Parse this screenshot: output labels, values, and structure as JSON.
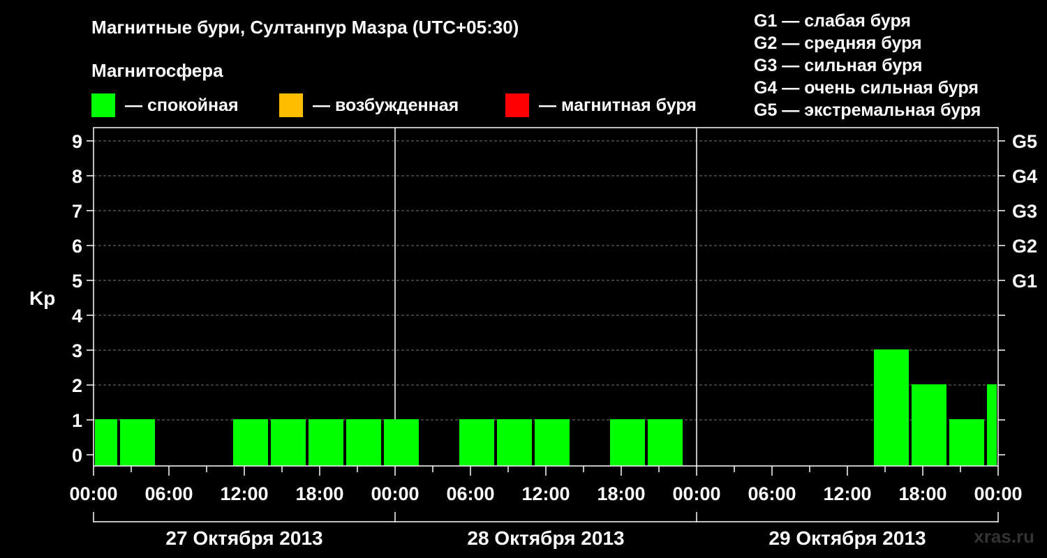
{
  "title": "Магнитные бури, Султанпур Мазра (UTC+05:30)",
  "section_label": "Магнитосфера",
  "legend": [
    {
      "color": "#00ff00",
      "label": "— спокойная"
    },
    {
      "color": "#ffbf00",
      "label": "— возбужденная"
    },
    {
      "color": "#ff0000",
      "label": "— магнитная буря"
    }
  ],
  "g_scale": [
    "G1 — слабая буря",
    "G2 — средняя буря",
    "G3 — сильная буря",
    "G4 — очень сильная буря",
    "G5 — экстремальная буря"
  ],
  "watermark": "xras.ru",
  "chart_data": {
    "type": "bar",
    "ylabel": "Kp",
    "ylim": [
      0,
      9
    ],
    "yticks": [
      0,
      1,
      2,
      3,
      4,
      5,
      6,
      7,
      8,
      9
    ],
    "right_axis_labels": [
      {
        "kp": 5,
        "label": "G1"
      },
      {
        "kp": 6,
        "label": "G2"
      },
      {
        "kp": 7,
        "label": "G3"
      },
      {
        "kp": 8,
        "label": "G4"
      },
      {
        "kp": 9,
        "label": "G5"
      }
    ],
    "x_tick_labels": [
      "00:00",
      "06:00",
      "12:00",
      "18:00",
      "00:00",
      "06:00",
      "12:00",
      "18:00",
      "00:00",
      "06:00",
      "12:00",
      "18:00",
      "00:00"
    ],
    "days": [
      "27 Октября 2013",
      "28 Октября 2013",
      "29 Октября 2013"
    ],
    "grid": true,
    "bars": [
      {
        "start": "2013-10-27 00:00",
        "end": "2013-10-27 02:00",
        "kp": 1,
        "color": "#00ff00"
      },
      {
        "start": "2013-10-27 02:00",
        "end": "2013-10-27 05:00",
        "kp": 1,
        "color": "#00ff00"
      },
      {
        "start": "2013-10-27 05:00",
        "end": "2013-10-27 08:00",
        "kp": 0,
        "color": "#00ff00"
      },
      {
        "start": "2013-10-27 08:00",
        "end": "2013-10-27 11:00",
        "kp": 0,
        "color": "#00ff00"
      },
      {
        "start": "2013-10-27 11:00",
        "end": "2013-10-27 14:00",
        "kp": 1,
        "color": "#00ff00"
      },
      {
        "start": "2013-10-27 14:00",
        "end": "2013-10-27 17:00",
        "kp": 1,
        "color": "#00ff00"
      },
      {
        "start": "2013-10-27 17:00",
        "end": "2013-10-27 20:00",
        "kp": 1,
        "color": "#00ff00"
      },
      {
        "start": "2013-10-27 20:00",
        "end": "2013-10-27 23:00",
        "kp": 1,
        "color": "#00ff00"
      },
      {
        "start": "2013-10-27 23:00",
        "end": "2013-10-28 02:00",
        "kp": 1,
        "color": "#00ff00"
      },
      {
        "start": "2013-10-28 02:00",
        "end": "2013-10-28 05:00",
        "kp": 0,
        "color": "#00ff00"
      },
      {
        "start": "2013-10-28 05:00",
        "end": "2013-10-28 08:00",
        "kp": 1,
        "color": "#00ff00"
      },
      {
        "start": "2013-10-28 08:00",
        "end": "2013-10-28 11:00",
        "kp": 1,
        "color": "#00ff00"
      },
      {
        "start": "2013-10-28 11:00",
        "end": "2013-10-28 14:00",
        "kp": 1,
        "color": "#00ff00"
      },
      {
        "start": "2013-10-28 14:00",
        "end": "2013-10-28 17:00",
        "kp": 0,
        "color": "#00ff00"
      },
      {
        "start": "2013-10-28 17:00",
        "end": "2013-10-28 20:00",
        "kp": 1,
        "color": "#00ff00"
      },
      {
        "start": "2013-10-28 20:00",
        "end": "2013-10-28 23:00",
        "kp": 1,
        "color": "#00ff00"
      },
      {
        "start": "2013-10-28 23:00",
        "end": "2013-10-29 02:00",
        "kp": 0,
        "color": "#00ff00"
      },
      {
        "start": "2013-10-29 02:00",
        "end": "2013-10-29 05:00",
        "kp": 0,
        "color": "#00ff00"
      },
      {
        "start": "2013-10-29 05:00",
        "end": "2013-10-29 08:00",
        "kp": 0,
        "color": "#00ff00"
      },
      {
        "start": "2013-10-29 08:00",
        "end": "2013-10-29 11:00",
        "kp": 0,
        "color": "#00ff00"
      },
      {
        "start": "2013-10-29 11:00",
        "end": "2013-10-29 14:00",
        "kp": 0,
        "color": "#00ff00"
      },
      {
        "start": "2013-10-29 14:00",
        "end": "2013-10-29 17:00",
        "kp": 3,
        "color": "#00ff00"
      },
      {
        "start": "2013-10-29 17:00",
        "end": "2013-10-29 20:00",
        "kp": 2,
        "color": "#00ff00"
      },
      {
        "start": "2013-10-29 20:00",
        "end": "2013-10-29 23:00",
        "kp": 1,
        "color": "#00ff00"
      },
      {
        "start": "2013-10-29 23:00",
        "end": "2013-10-30 00:00",
        "kp": 2,
        "color": "#00ff00"
      }
    ]
  }
}
